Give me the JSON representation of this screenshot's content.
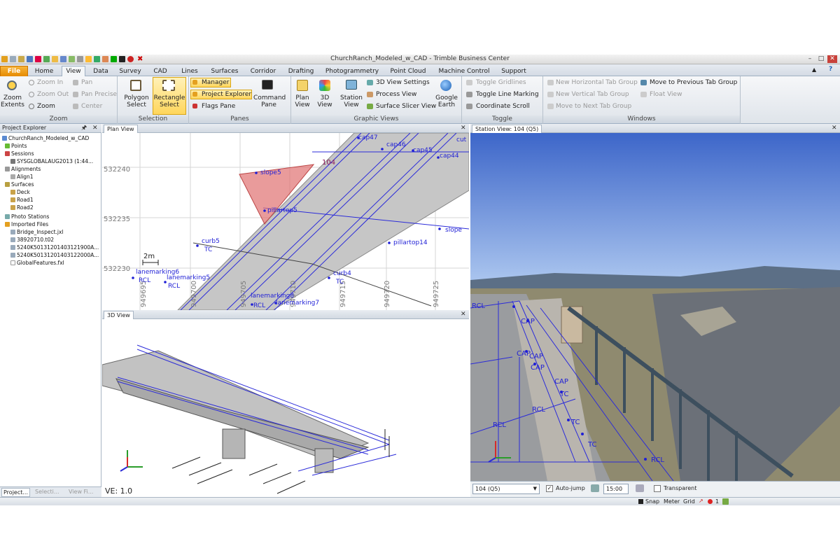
{
  "window": {
    "title": "ChurchRanch_Modeled_w_CAD - Trimble Business Center",
    "minimize": "–",
    "maximize": "□",
    "close": "✕",
    "help": "?",
    "collapse": "▲"
  },
  "tabs": [
    "File",
    "Home",
    "View",
    "Data",
    "Survey",
    "CAD",
    "Lines",
    "Surfaces",
    "Corridor",
    "Drafting",
    "Photogrammetry",
    "Point Cloud",
    "Machine Control",
    "Support"
  ],
  "ribbon": {
    "zoom": {
      "label": "Zoom",
      "extents": "Zoom Extents",
      "zoom_in": "Zoom In",
      "zoom_out": "Zoom Out",
      "zoom": "Zoom",
      "pan": "Pan",
      "pan_precise": "Pan Precise",
      "center": "Center"
    },
    "selection": {
      "label": "Selection",
      "polygon": "Polygon Select",
      "rectangle": "Rectangle Select"
    },
    "panes": {
      "label": "Panes",
      "manager": "Manager",
      "project_explorer": "Project Explorer",
      "flags": "Flags Pane",
      "command": "Command Pane"
    },
    "graphic_views": {
      "label": "Graphic Views",
      "plan": "Plan View",
      "view3d": "3D View",
      "station": "Station View",
      "settings_3d": "3D View Settings",
      "process": "Process View",
      "surface_slicer": "Surface Slicer View",
      "google_earth": "Google Earth"
    },
    "toggle": {
      "label": "Toggle",
      "gridlines": "Toggle Gridlines",
      "line_marking": "Toggle Line Marking",
      "coord_scroll": "Coordinate Scroll"
    },
    "windows": {
      "label": "Windows",
      "new_h": "New Horizontal Tab Group",
      "new_v": "New Vertical Tab Group",
      "move_next": "Move to Next Tab Group",
      "move_prev": "Move to Previous Tab Group",
      "float": "Float View"
    }
  },
  "explorer": {
    "title": "Project Explorer",
    "pin": "🖈",
    "close": "✕",
    "items": [
      "ChurchRanch_Modeled_w_CAD",
      "Points",
      "Sessions",
      "SYSGLOBALAUG2013 (1:44...",
      "Alignments",
      "Align1",
      "Surfaces",
      "Deck",
      "Road1",
      "Road2",
      "Photo Stations",
      "Imported Files",
      "Bridge_Inspect.jxl",
      "38920710.t02",
      "5240K50131201403121900A...",
      "5240K50131201403122000A...",
      "GlobalFeatures.fxl"
    ],
    "bottom_tabs": [
      "Project...",
      "Selecti...",
      "View Fi..."
    ]
  },
  "plan": {
    "tab": "Plan View",
    "close": "✕",
    "northings": [
      "532240",
      "532235",
      "532230"
    ],
    "eastings": [
      "949695",
      "949700",
      "949705",
      "949710",
      "949715",
      "949720",
      "949725"
    ],
    "scale": "2m",
    "labels": [
      "cap47",
      "cap46",
      "cap45",
      "cap44",
      "cut",
      "104",
      "slope5",
      "pillartop5",
      "slope",
      "pillartop14",
      "curb5",
      "TC",
      "curb4",
      "TC",
      "lanemarking6",
      "RCL",
      "lanemarking5",
      "RCL",
      "lanemarking8",
      "RCL",
      "lanemarking7"
    ]
  },
  "view3d": {
    "tab": "3D View",
    "close": "✕",
    "ve": "VE: 1.0"
  },
  "station": {
    "tab": "Station View: 104 (Q5)",
    "close": "✕",
    "labels": [
      "RCL",
      "CAP",
      "CAP",
      "CAP",
      "CAP",
      "TC",
      "RCL",
      "RCL",
      "TC",
      "TC",
      "RCL",
      "CAP"
    ],
    "select": "104 (Q5)",
    "autojump": "Auto-jump",
    "time": "15:00",
    "transparent": "Transparent"
  },
  "status": {
    "snap": "Snap",
    "units": "Meter",
    "grid": "Grid",
    "count": "1"
  },
  "colors": {
    "accent": "#f29b0d",
    "label_blue": "#1f1fd6",
    "ribbon_bg": "#e3e8ee"
  }
}
